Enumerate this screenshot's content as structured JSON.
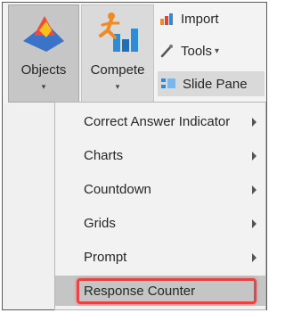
{
  "ribbon": {
    "objects": {
      "label": "Objects",
      "icon": "objects-shapes-icon"
    },
    "compete": {
      "label": "Compete",
      "icon": "compete-runner-chart-icon"
    },
    "import": {
      "label": "Import",
      "icon": "import-icon"
    },
    "tools": {
      "label": "Tools",
      "icon": "tools-icon",
      "caret": "▾"
    },
    "slide_pane": {
      "label": "Slide Pane",
      "icon": "slide-pane-icon"
    },
    "chevron": "▾"
  },
  "menu": {
    "items": [
      {
        "label": "Correct Answer Indicator",
        "has_submenu": true
      },
      {
        "label": "Charts",
        "has_submenu": true
      },
      {
        "label": "Countdown",
        "has_submenu": true
      },
      {
        "label": "Grids",
        "has_submenu": true
      },
      {
        "label": "Prompt",
        "has_submenu": true
      },
      {
        "label": "Response Counter",
        "has_submenu": false,
        "highlighted": true
      }
    ]
  },
  "colors": {
    "highlight_box": "#e64545",
    "accent_blue": "#2f8bd6",
    "accent_orange": "#f08a24"
  }
}
